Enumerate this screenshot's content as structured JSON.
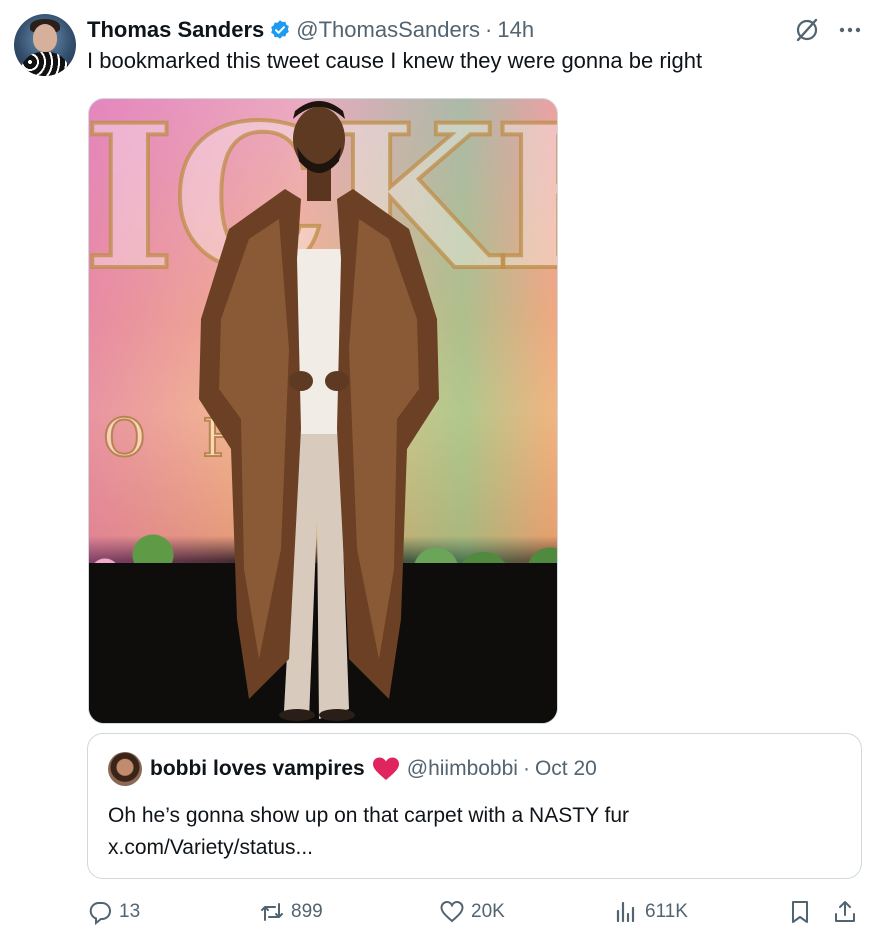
{
  "tweet": {
    "author": {
      "display_name": "Thomas Sanders",
      "handle": "@ThomasSanders",
      "verified": true
    },
    "separator": "·",
    "time": "14h",
    "text": "I bookmarked this tweet cause I knew they were gonna be right",
    "image": {
      "backdrop_text": "ICKED",
      "backdrop_subtext": "O F    D"
    },
    "quoted": {
      "display_name": "bobbi loves vampires",
      "handle": "@hiimbobbi",
      "separator": "·",
      "time": "Oct 20",
      "text": "Oh he’s gonna show up on that carpet with a NASTY fur",
      "link": "x.com/Variety/status..."
    },
    "actions": {
      "replies": "13",
      "reposts": "899",
      "likes": "20K",
      "views": "611K"
    },
    "colors": {
      "text_primary": "#0f1419",
      "text_secondary": "#536471",
      "verified_blue": "#1d9bf0",
      "heart_red": "#e0245e",
      "border": "#cfd9de"
    }
  }
}
